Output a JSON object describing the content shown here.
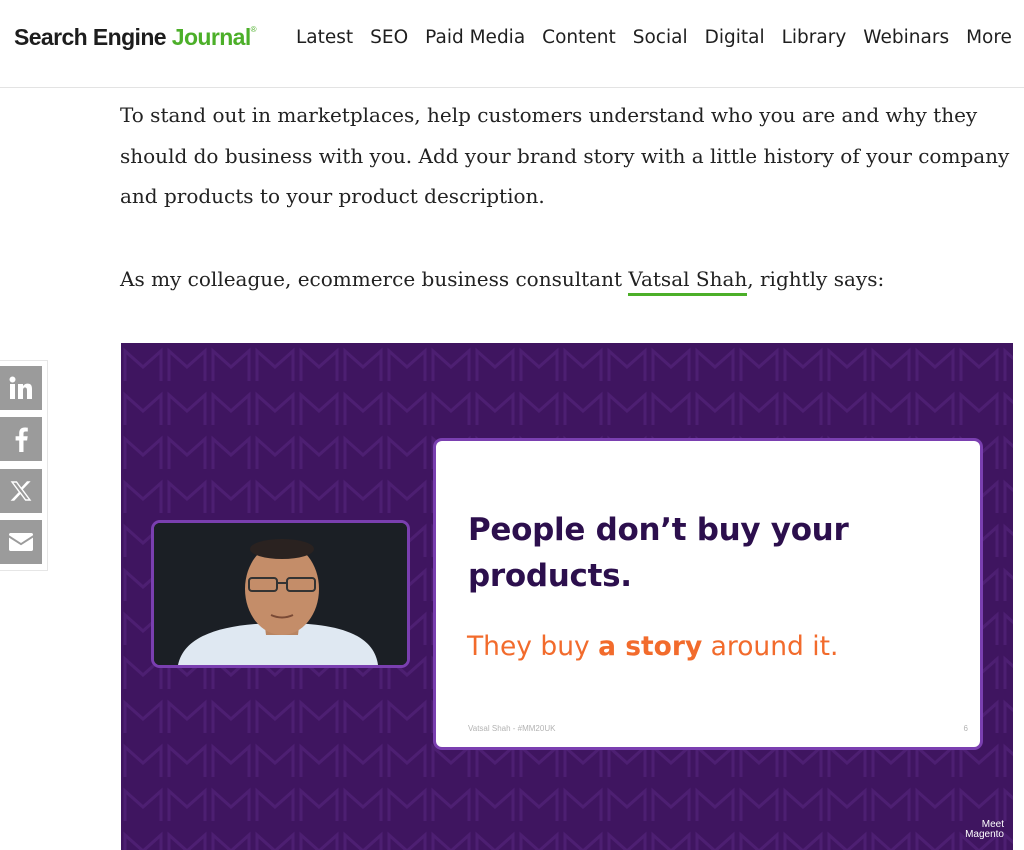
{
  "header": {
    "logo_part1": "Search Engine",
    "logo_part2": "Journal",
    "logo_mark": "®",
    "nav": [
      "Latest",
      "SEO",
      "Paid Media",
      "Content",
      "Social",
      "Digital",
      "Library",
      "Webinars",
      "More"
    ]
  },
  "article": {
    "paragraph1": "To stand out in marketplaces, help customers understand who you are and why they should do business with you. Add your brand story with a little history of your company and products to your product description.",
    "paragraph2_before": "As my colleague, ecommerce business consultant ",
    "paragraph2_link": "Vatsal Shah",
    "paragraph2_after": ", rightly says:"
  },
  "share": {
    "icons": [
      "linkedin-icon",
      "facebook-icon",
      "x-icon",
      "email-icon"
    ]
  },
  "video": {
    "slide_heading": "People don’t buy your products.",
    "slide_sub_before": "They buy ",
    "slide_sub_bold": "a story",
    "slide_sub_after": " around it.",
    "slide_footer": "Vatsal Shah - #MM20UK",
    "slide_number": "6",
    "brand_line1": "Meet",
    "brand_line2": "Magento"
  },
  "colors": {
    "brand_green": "#4caf29",
    "video_purple": "#3f1560",
    "slide_heading": "#2c0f4d",
    "slide_orange": "#f26b2c",
    "share_gray": "#9b9b9b"
  }
}
